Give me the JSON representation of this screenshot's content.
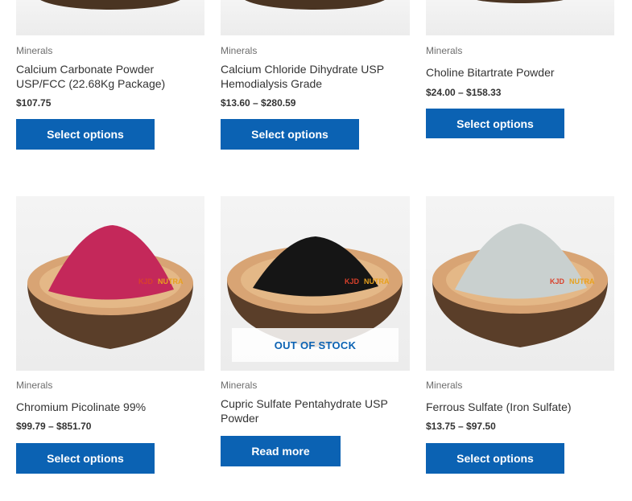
{
  "products": [
    {
      "category": "Minerals",
      "title": "Calcium Carbonate Powder USP/FCC (22.68Kg Package)",
      "price": "$107.75",
      "button": "Select options"
    },
    {
      "category": "Minerals",
      "title": "Calcium Chloride Dihydrate USP Hemodialysis Grade",
      "price": "$13.60 – $280.59",
      "button": "Select options"
    },
    {
      "category": "Minerals",
      "title": "Choline Bitartrate Powder",
      "price": "$24.00 – $158.33",
      "button": "Select options"
    },
    {
      "category": "Minerals",
      "title": "Chromium Picolinate 99%",
      "price": "$99.79 – $851.70",
      "button": "Select options",
      "powder_color": "#c4285a"
    },
    {
      "category": "Minerals",
      "title": "Cupric Sulfate Pentahydrate USP Powder",
      "price": "",
      "button": "Read more",
      "badge": "OUT OF STOCK",
      "powder_color": "#151515"
    },
    {
      "category": "Minerals",
      "title": "Ferrous Sulfate (Iron Sulfate)",
      "price": "$13.75 – $97.50",
      "button": "Select options",
      "powder_color": "#c9d0cf"
    }
  ],
  "logo": {
    "kjd": "KJD",
    "nutra": "NUTRA"
  },
  "colors": {
    "button": "#0b62b3",
    "logo_red": "#d9412b",
    "logo_orange": "#e8a11d"
  }
}
